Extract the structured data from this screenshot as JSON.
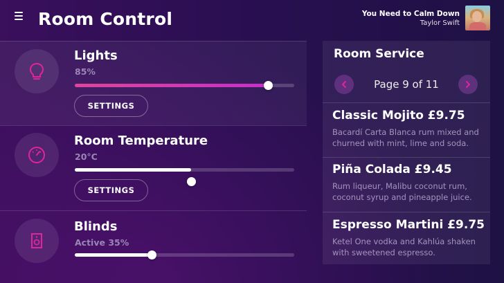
{
  "header": {
    "title": "Room Control"
  },
  "now_playing": {
    "song": "You Need to Calm Down",
    "artist": "Taylor Swift"
  },
  "controls": [
    {
      "name": "Lights",
      "value": "85%",
      "level": 0.88,
      "button": "SETTINGS",
      "icon": "lightbulb-icon"
    },
    {
      "name": "Room Temperature",
      "value": "20°C",
      "level": 0.53,
      "button": "SETTINGS",
      "icon": "thermostat-icon"
    },
    {
      "name": "Blinds",
      "value": "Active 35%",
      "level": 0.35,
      "icon": "blinds-icon"
    }
  ],
  "room_service": {
    "title": "Room Service",
    "page_text": "Page 9 of 11",
    "items": [
      {
        "name": "Classic Mojito £9.75",
        "desc": "Bacardí Carta Blanca rum mixed and churned with mint, lime and soda."
      },
      {
        "name": "Piña Colada £9.45",
        "desc": "Rum liqueur, Malibu coconut rum, coconut syrup and pineapple juice."
      },
      {
        "name": "Espresso Martini £9.75",
        "desc": "Ketel One vodka and Kahlúa shaken with sweetened espresso."
      }
    ]
  },
  "colors": {
    "accent": "#e0249a",
    "accent_light": "#d84fd0",
    "slider_fill_gradient_start": "#e0449a"
  }
}
